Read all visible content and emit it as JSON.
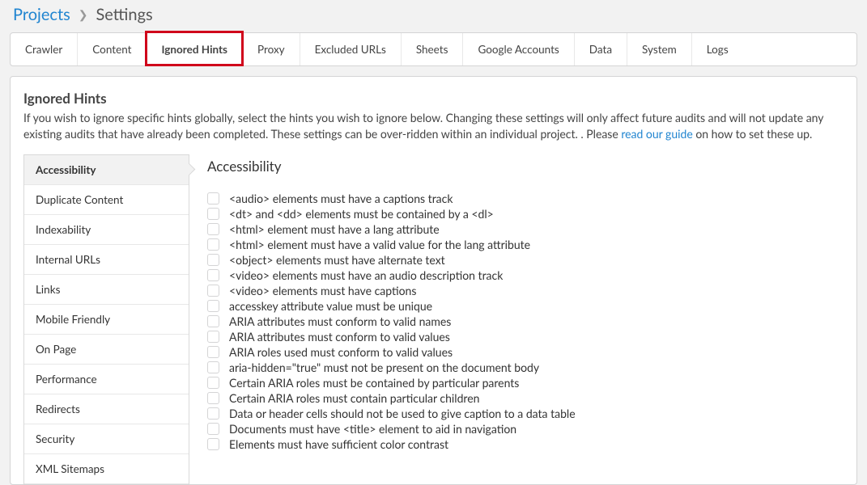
{
  "breadcrumb": {
    "link": "Projects",
    "current": "Settings"
  },
  "tabs": [
    "Crawler",
    "Content",
    "Ignored Hints",
    "Proxy",
    "Excluded URLs",
    "Sheets",
    "Google Accounts",
    "Data",
    "System",
    "Logs"
  ],
  "activeTab": "Ignored Hints",
  "section": {
    "title": "Ignored Hints",
    "intro_before": "If you wish to ignore specific hints globally, select the hints you wish to ignore below. Changing these settings will only affect future audits and will not update any existing audits that have already been completed. These settings can be over-ridden within an individual project. . Please ",
    "intro_link": "read our guide",
    "intro_after": " on how to set these up."
  },
  "sidebar": {
    "items": [
      "Accessibility",
      "Duplicate Content",
      "Indexability",
      "Internal URLs",
      "Links",
      "Mobile Friendly",
      "On Page",
      "Performance",
      "Redirects",
      "Security",
      "XML Sitemaps"
    ],
    "active": "Accessibility"
  },
  "hints": {
    "heading": "Accessibility",
    "items": [
      "<audio> elements must have a captions track",
      "<dt> and <dd> elements must be contained by a <dl>",
      "<html> element must have a lang attribute",
      "<html> element must have a valid value for the lang attribute",
      "<object> elements must have alternate text",
      "<video> elements must have an audio description track",
      "<video> elements must have captions",
      "accesskey attribute value must be unique",
      "ARIA attributes must conform to valid names",
      "ARIA attributes must conform to valid values",
      "ARIA roles used must conform to valid values",
      "aria-hidden=\"true\" must not be present on the document body",
      "Certain ARIA roles must be contained by particular parents",
      "Certain ARIA roles must contain particular children",
      "Data or header cells should not be used to give caption to a data table",
      "Documents must have <title> element to aid in navigation",
      "Elements must have sufficient color contrast"
    ]
  }
}
